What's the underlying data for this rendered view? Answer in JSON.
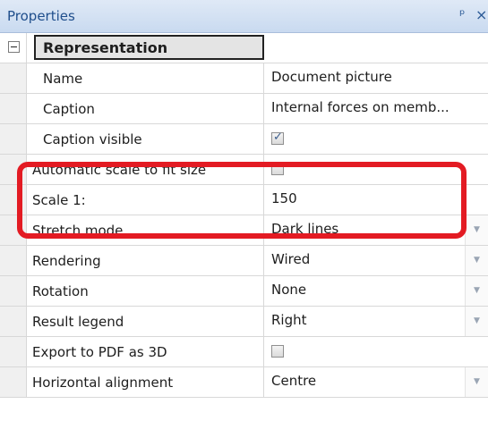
{
  "panel": {
    "title": "Properties",
    "pin_glyph": "ᵖ",
    "close_glyph": "×"
  },
  "category": {
    "label": "Representation",
    "expander": "minus-box-icon"
  },
  "rows": [
    {
      "name": "Name",
      "value": "Document picture",
      "type": "text"
    },
    {
      "name": "Caption",
      "value": "Internal forces on memb...",
      "type": "text"
    },
    {
      "name": "Caption visible",
      "value": "",
      "type": "checkbox",
      "checked": true
    },
    {
      "name": "Automatic scale to fit size",
      "value": "",
      "type": "checkbox",
      "checked": false
    },
    {
      "name": "Scale 1:",
      "value": "150",
      "type": "text"
    },
    {
      "name": "Stretch mode",
      "value": "Dark lines",
      "type": "dropdown"
    },
    {
      "name": "Rendering",
      "value": "Wired",
      "type": "dropdown"
    },
    {
      "name": "Rotation",
      "value": "None",
      "type": "dropdown"
    },
    {
      "name": "Result legend",
      "value": "Right",
      "type": "dropdown"
    },
    {
      "name": "Export to PDF as 3D",
      "value": "",
      "type": "checkbox",
      "checked": false
    },
    {
      "name": "Horizontal alignment",
      "value": "Centre",
      "type": "dropdown"
    }
  ],
  "dropdown_arrow": "▼",
  "colors": {
    "highlight_border": "#e31b23",
    "title_text": "#1f4e8c"
  }
}
